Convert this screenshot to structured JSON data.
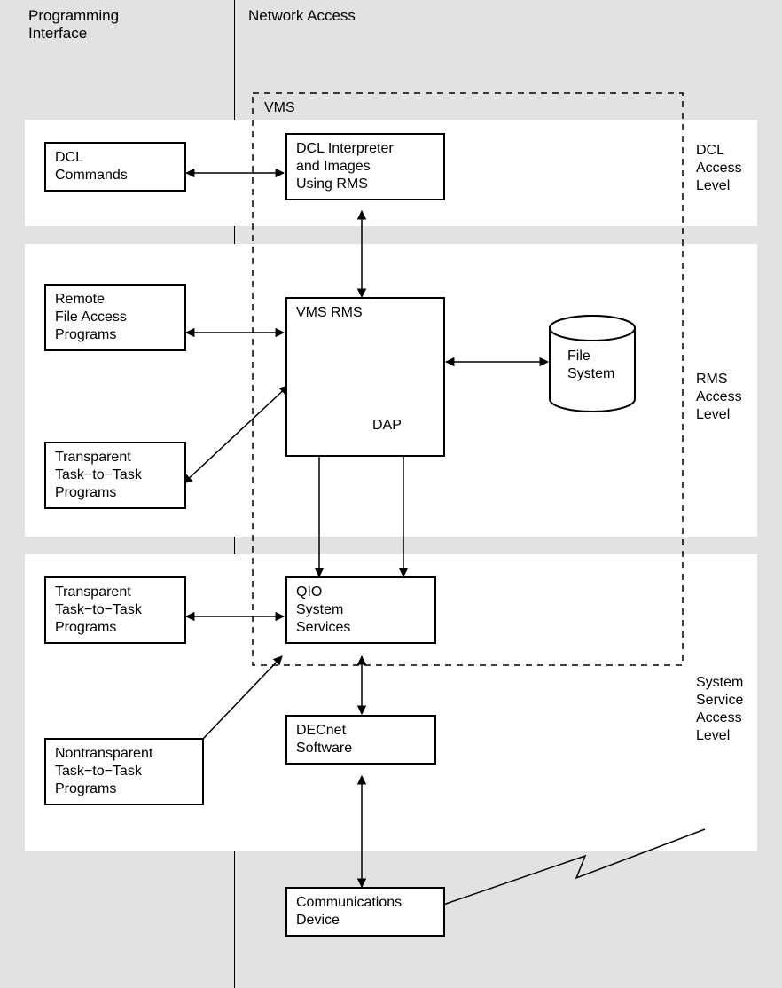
{
  "headers": {
    "left": "Programming\nInterface",
    "right": "Network Access"
  },
  "vms_label": "VMS",
  "levels": {
    "dcl": "DCL\nAccess\nLevel",
    "rms": "RMS\nAccess\nLevel",
    "sys": "System\nService\nAccess\nLevel"
  },
  "boxes": {
    "dcl_commands": "DCL\nCommands",
    "dcl_interpreter": "DCL Interpreter\nand Images\nUsing RMS",
    "remote_file": "Remote\nFile Access\nPrograms",
    "vms_rms": "VMS RMS",
    "dap": "DAP",
    "file_system": "File\nSystem",
    "transparent_rms": "Transparent\nTask−to−Task\nPrograms",
    "transparent_sys": "Transparent\nTask−to−Task\nPrograms",
    "qio": "QIO\nSystem\nServices",
    "nontransparent": "Nontransparent\nTask−to−Task\nPrograms",
    "decnet": "DECnet\nSoftware",
    "comm": "Communications\nDevice"
  }
}
